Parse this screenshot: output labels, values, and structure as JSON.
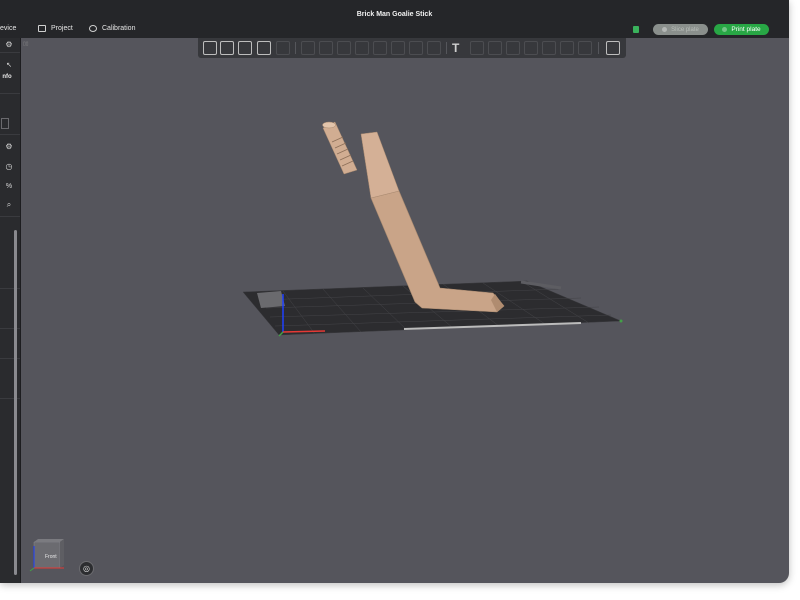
{
  "window": {
    "title": "Brick Man Goalie Stick"
  },
  "nav": {
    "device_partial": "evice",
    "project": "Project",
    "calibration": "Calibration"
  },
  "actions": {
    "slice_plate": "Slice plate",
    "print_plate": "Print plate"
  },
  "sidebar": {
    "info_partial": "nfo",
    "percent_symbol": "%"
  },
  "viewport": {
    "cube_label": "Front",
    "colors": {
      "background": "#55555c",
      "plate": "#2c2c2f",
      "model": "#c9a488",
      "x_axis": "#e53935",
      "y_axis": "#43a047",
      "z_axis": "#1e40ff"
    }
  },
  "toolbar": {
    "icons": [
      "add-object-icon",
      "arrange-icon",
      "auto-orient-icon",
      "plate-settings-icon",
      "text-tool-icon",
      "assembly-view-icon"
    ]
  }
}
